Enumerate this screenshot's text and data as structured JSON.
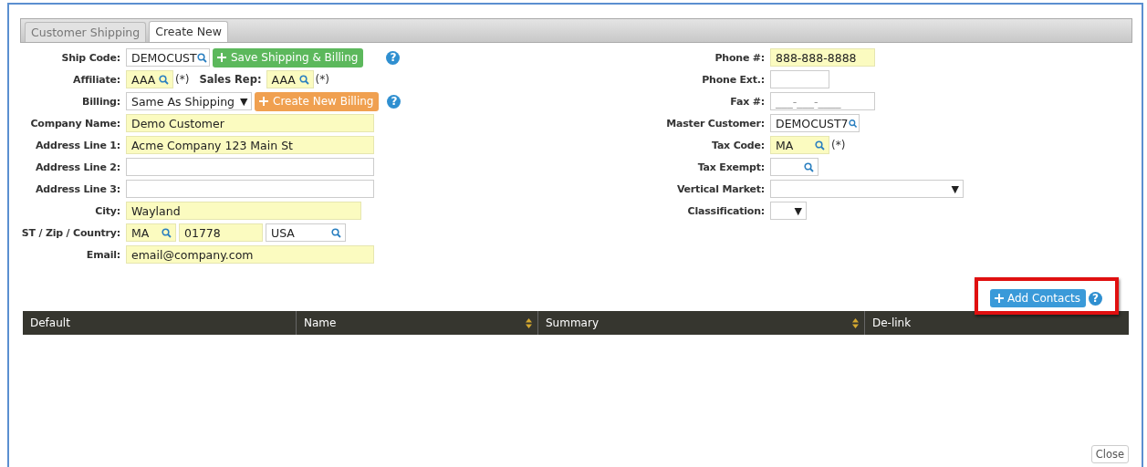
{
  "tabs": [
    {
      "label": "Customer Shipping",
      "selected": false
    },
    {
      "label": "Create New",
      "selected": true
    }
  ],
  "left_rows": [
    {
      "label": "Ship Code:",
      "controls": [
        {
          "kind": "lookup",
          "value": "DEMOCUST",
          "highlighted": false
        },
        {
          "kind": "button",
          "label": "Save Shipping & Billing",
          "color": "#5cb85c"
        },
        {
          "kind": "help",
          "glyph": "?"
        }
      ]
    },
    {
      "label": "Affiliate:",
      "controls": [
        {
          "kind": "lookup",
          "value": "AAA",
          "highlighted": true,
          "suffix": "(*)"
        },
        {
          "kind": "label",
          "text": "Sales Rep:"
        },
        {
          "kind": "lookup",
          "value": "AAA",
          "highlighted": true,
          "suffix": "(*)"
        }
      ]
    },
    {
      "label": "Billing:",
      "controls": [
        {
          "kind": "select",
          "value": "Same As Shipping",
          "caret": "▼",
          "highlighted": false
        },
        {
          "kind": "button",
          "label": "Create New Billing",
          "color": "#f0a050"
        },
        {
          "kind": "help",
          "glyph": "?"
        }
      ]
    },
    {
      "label": "Company Name:",
      "controls": [
        {
          "kind": "text",
          "value": "Demo Customer",
          "highlighted": true
        }
      ]
    },
    {
      "label": "Address Line 1:",
      "controls": [
        {
          "kind": "text",
          "value": "Acme Company 123 Main St",
          "highlighted": true
        }
      ]
    },
    {
      "label": "Address Line 2:",
      "controls": [
        {
          "kind": "text",
          "highlighted": false
        }
      ]
    },
    {
      "label": "Address Line 3:",
      "controls": [
        {
          "kind": "text",
          "highlighted": false
        }
      ]
    },
    {
      "label": "City:",
      "controls": [
        {
          "kind": "text",
          "value": "Wayland",
          "highlighted": true
        }
      ]
    },
    {
      "label": "ST / Zip / Country:",
      "controls": [
        {
          "kind": "lookup",
          "value": "MA",
          "highlighted": true
        },
        {
          "kind": "text",
          "value": "01778",
          "highlighted": true
        },
        {
          "kind": "lookup",
          "value": "USA",
          "highlighted": false
        }
      ]
    },
    {
      "label": "Email:",
      "controls": [
        {
          "kind": "text",
          "value": "email@company.com",
          "highlighted": true
        }
      ]
    }
  ],
  "right_rows": [
    {
      "label": "Phone #:",
      "controls": [
        {
          "kind": "text",
          "value": "888-888-8888",
          "highlighted": true
        }
      ]
    },
    {
      "label": "Phone Ext.:",
      "controls": [
        {
          "kind": "text",
          "highlighted": false
        }
      ]
    },
    {
      "label": "Fax #:",
      "controls": [
        {
          "kind": "text",
          "placeholder": "___-___-____",
          "highlighted": false
        }
      ]
    },
    {
      "label": "Master Customer:",
      "controls": [
        {
          "kind": "lookup",
          "value": "DEMOCUST7",
          "highlighted": false
        }
      ]
    },
    {
      "label": "Tax Code:",
      "controls": [
        {
          "kind": "lookup",
          "value": "MA",
          "highlighted": true,
          "suffix": "(*)"
        }
      ]
    },
    {
      "label": "Tax Exempt:",
      "controls": [
        {
          "kind": "lookup",
          "highlighted": false
        }
      ]
    },
    {
      "label": "Vertical Market:",
      "controls": [
        {
          "kind": "select",
          "caret": "▼",
          "highlighted": false
        }
      ]
    },
    {
      "label": "Classification:",
      "controls": [
        {
          "kind": "select",
          "caret": "▼",
          "highlighted": false
        }
      ]
    }
  ],
  "contacts": {
    "add_button": "Add Contacts",
    "help_glyph": "?",
    "highlighted": true,
    "columns": [
      {
        "label": "Default",
        "sortable": false
      },
      {
        "label": "Name",
        "sortable": true
      },
      {
        "label": "Summary",
        "sortable": true
      },
      {
        "label": "De-link",
        "sortable": false
      }
    ]
  },
  "close_button": "Close"
}
